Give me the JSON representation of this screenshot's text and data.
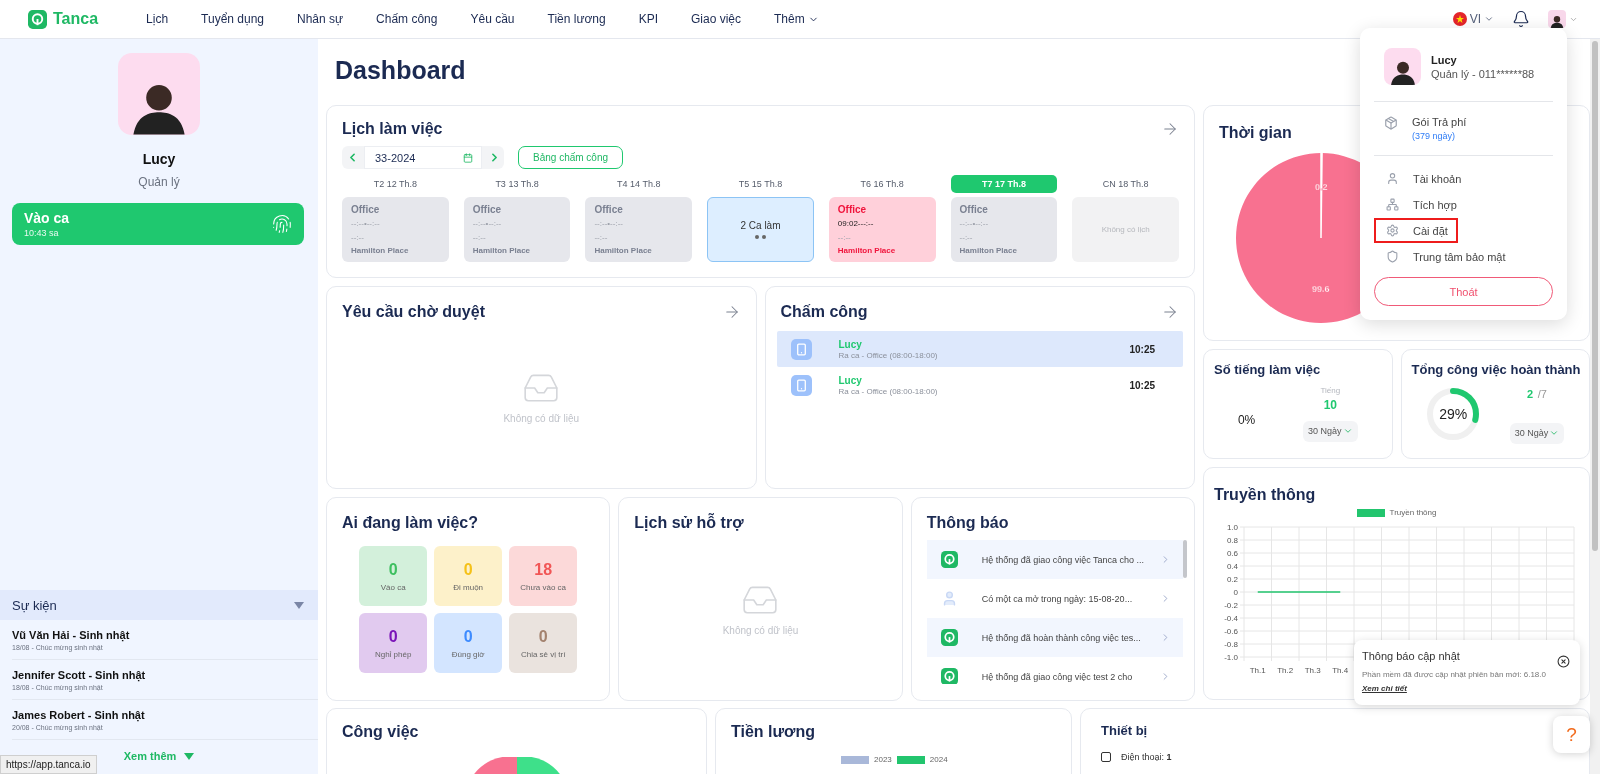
{
  "nav": {
    "brand": "Tanca",
    "items": [
      "Lịch",
      "Tuyển dụng",
      "Nhân sự",
      "Chấm công",
      "Yêu cầu",
      "Tiền lương",
      "KPI",
      "Giao việc"
    ],
    "more": "Thêm",
    "language": "VI"
  },
  "sidebar": {
    "name": "Lucy",
    "role": "Quản lý",
    "check_in": {
      "label": "Vào ca",
      "time": "10:43 sa"
    },
    "events_title": "Sự kiện",
    "events": [
      {
        "name": "Vũ Văn Hải - Sinh nhật",
        "detail": "18/08 - Chúc mừng sinh nhật"
      },
      {
        "name": "Jennifer Scott - Sinh nhật",
        "detail": "18/08 - Chúc mừng sinh nhật"
      },
      {
        "name": "James Robert - Sinh nhật",
        "detail": "20/08 - Chúc mừng sinh nhật"
      }
    ],
    "see_more": "Xem thêm"
  },
  "page_title": "Dashboard",
  "schedule": {
    "title": "Lịch làm việc",
    "week": "33-2024",
    "timesheet_button": "Bảng chấm công",
    "days": [
      {
        "label": "T2 12 Th.8",
        "selected": false,
        "kind": "shift",
        "place": "Office",
        "time": "--:--•--:--",
        "time2": "--:--",
        "location": "Hamilton Place"
      },
      {
        "label": "T3 13 Th.8",
        "selected": false,
        "kind": "shift",
        "place": "Office",
        "time": "--:--•--:--",
        "time2": "--:--",
        "location": "Hamilton Place"
      },
      {
        "label": "T4 14 Th.8",
        "selected": false,
        "kind": "shift",
        "place": "Office",
        "time": "--:--•--:--",
        "time2": "--:--",
        "location": "Hamilton Place"
      },
      {
        "label": "T5 15 Th.8",
        "selected": false,
        "kind": "multi",
        "text": "2 Ca làm"
      },
      {
        "label": "T6 16 Th.8",
        "selected": false,
        "kind": "late",
        "place": "Office",
        "time": "09:02---:--",
        "time2": "--:--",
        "location": "Hamilton Place"
      },
      {
        "label": "T7 17 Th.8",
        "selected": true,
        "kind": "shift",
        "place": "Office",
        "time": "--:--•--:--",
        "time2": "--:--",
        "location": "Hamilton Place"
      },
      {
        "label": "CN 18 Th.8",
        "selected": false,
        "kind": "empty",
        "text": "Không có lịch"
      }
    ]
  },
  "pending_requests": {
    "title": "Yêu cầu chờ duyệt",
    "empty_text": "Không có dữ liệu"
  },
  "attendance": {
    "title": "Chấm công",
    "rows": [
      {
        "name": "Lucy",
        "detail": "Ra ca - Office (08:00-18:00)",
        "time": "10:25",
        "selected": true
      },
      {
        "name": "Lucy",
        "detail": "Ra ca - Office (08:00-18:00)",
        "time": "10:25",
        "selected": false
      }
    ]
  },
  "who_working": {
    "title": "Ai đang làm việc?",
    "stats": [
      {
        "value": "0",
        "label": "Vào ca",
        "color": "#3dbf5f"
      },
      {
        "value": "0",
        "label": "Đi muộn",
        "color": "#f5c118"
      },
      {
        "value": "18",
        "label": "Chưa vào ca",
        "color": "#f15656"
      },
      {
        "value": "0",
        "label": "Nghỉ phép",
        "color": "#7a14b8"
      },
      {
        "value": "0",
        "label": "Đúng giờ",
        "color": "#3d8bff"
      },
      {
        "value": "0",
        "label": "Chia sẻ vị trí",
        "color": "#a3826e"
      }
    ]
  },
  "support_history": {
    "title": "Lịch sử hỗ trợ",
    "empty_text": "Không có dữ liệu"
  },
  "notifications": {
    "title": "Thông báo",
    "items": [
      {
        "kind": "system",
        "text": "Hệ thống đã giao công việc Tanca cho ..."
      },
      {
        "kind": "user",
        "text": "Có một ca mở trong ngày: 15-08-20..."
      },
      {
        "kind": "system",
        "text": "Hệ thống đã hoàn thành công việc tes..."
      },
      {
        "kind": "system",
        "text": "Hệ thống đã giao công việc test 2 cho"
      }
    ]
  },
  "time_chart": {
    "title": "Thời gian",
    "chart_data": {
      "type": "pie",
      "values": [
        0.2,
        99.6
      ],
      "data_labels": true
    }
  },
  "hours": {
    "title": "Số tiếng làm việc",
    "percent": "0%",
    "unit": "Tiếng",
    "value": "10",
    "range": "30 Ngày"
  },
  "tasks_done": {
    "title": "Tổng công việc hoàn thành",
    "percent": "29%",
    "level": 0.29,
    "done": "2",
    "total": "/7",
    "range": "30 Ngày"
  },
  "media": {
    "title": "Truyền thông",
    "chart_data": {
      "type": "line",
      "grid": true,
      "categories": [
        "Th.1",
        "Th.2",
        "Th.3",
        "Th.4"
      ],
      "series": [
        {
          "name": "Truyền thông",
          "color": "#22c56e",
          "values": [
            0,
            0,
            0,
            0
          ]
        }
      ],
      "ylim": [
        -1,
        1
      ],
      "yticks": [
        {
          "value": 1,
          "label": "1.0"
        },
        0.8,
        0.6,
        0.4,
        0.2,
        0,
        -0.2,
        -0.4,
        -0.6,
        -0.8,
        {
          "value": -1,
          "label": "-1.0"
        }
      ]
    }
  },
  "tasks": {
    "title": "Công việc"
  },
  "payroll": {
    "title": "Tiền lương",
    "legend": [
      {
        "name": "2023",
        "color": "#a9b8d9"
      },
      {
        "name": "2024",
        "color": "#22c56e"
      }
    ]
  },
  "devices": {
    "title": "Thiết bị",
    "items": [
      "Điện thoại: **1**"
    ]
  },
  "profile_menu": {
    "name": "Lucy",
    "subtitle": "Quản lý - 011******88",
    "plan": "Gói Trả phí",
    "plan_days": "(379 ngày)",
    "items": [
      {
        "kind": "account",
        "label": "Tài khoản",
        "highlighted": false
      },
      {
        "kind": "integration",
        "label": "Tích hợp",
        "highlighted": false
      },
      {
        "kind": "settings",
        "label": "Cài đặt",
        "highlighted": true
      },
      {
        "kind": "security",
        "label": "Trung tâm bảo mật",
        "highlighted": false
      }
    ],
    "logout": "Thoát"
  },
  "update_toast": {
    "title": "Thông báo cập nhật",
    "message": "Phần mềm đã được cập nhật phiên bản mới: 6.18.0",
    "link": "Xem chi tiết"
  },
  "help_button": "?",
  "status_url": "https://app.tanca.io"
}
